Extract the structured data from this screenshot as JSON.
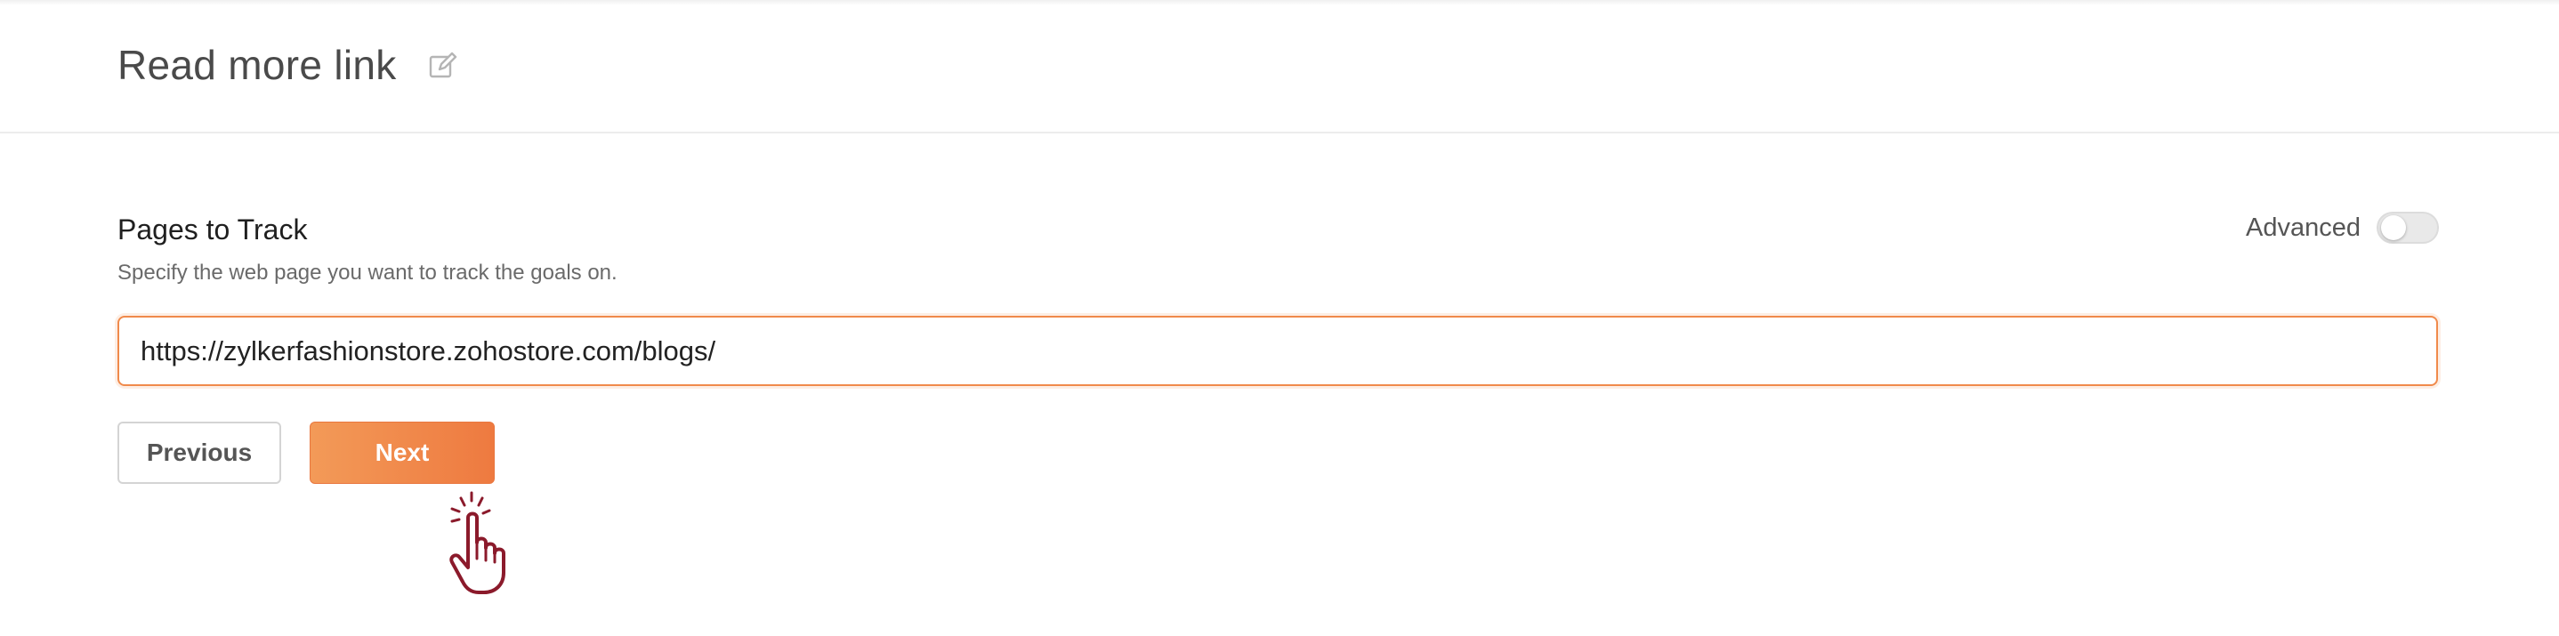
{
  "header": {
    "title": "Read more link",
    "edit_icon": "edit-pencil-icon"
  },
  "pages_to_track": {
    "label": "Pages to Track",
    "description": "Specify the web page you want to track the goals on.",
    "url_value": "https://zylkerfashionstore.zohostore.com/blogs/"
  },
  "advanced": {
    "label": "Advanced",
    "enabled": false
  },
  "actions": {
    "previous_label": "Previous",
    "next_label": "Next"
  },
  "colors": {
    "accent": "#ee7a40",
    "cursor": "#8b1a2b"
  }
}
